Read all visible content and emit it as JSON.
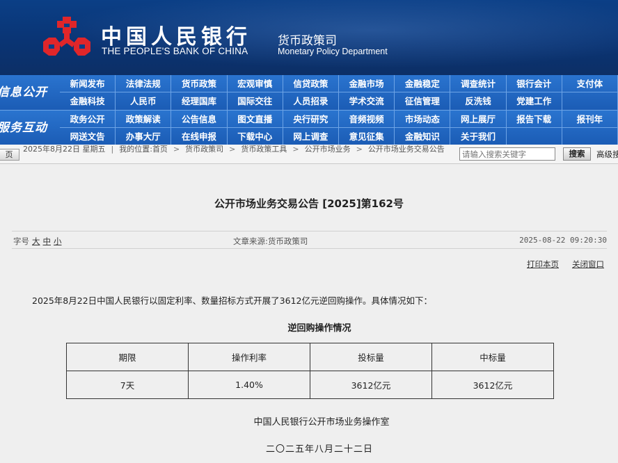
{
  "header": {
    "bank_name_cn": "中国人民银行",
    "bank_name_en": "THE PEOPLE'S BANK OF CHINA",
    "dept_cn": "货币政策司",
    "dept_en": "Monetary Policy Department",
    "logo_color": "#e0262a",
    "banner_color": "#0b3f86"
  },
  "nav": {
    "section1_title": "信息公开",
    "section2_title": "服务互动",
    "section1_row1": [
      "新闻发布",
      "法律法规",
      "货币政策",
      "宏观审慎",
      "信贷政策",
      "金融市场",
      "金融稳定",
      "调查统计",
      "银行会计",
      "支付体"
    ],
    "section1_row2": [
      "金融科技",
      "人民币",
      "经理国库",
      "国际交往",
      "人员招录",
      "学术交流",
      "征信管理",
      "反洗钱",
      "党建工作",
      ""
    ],
    "section2_row1": [
      "政务公开",
      "政策解读",
      "公告信息",
      "图文直播",
      "央行研究",
      "音频视频",
      "市场动态",
      "网上展厅",
      "报告下载",
      "报刊年"
    ],
    "section2_row2": [
      "网送文告",
      "办事大厅",
      "在线申报",
      "下载中心",
      "网上调查",
      "意见征集",
      "金融知识",
      "关于我们",
      "",
      ""
    ]
  },
  "breadcrumb": {
    "home_label": "页",
    "date": "2025年8月22日 星期五",
    "location_label": "我的位置:",
    "items": [
      "首页",
      "货币政策司",
      "货币政策工具",
      "公开市场业务",
      "公开市场业务交易公告"
    ]
  },
  "search": {
    "placeholder": "请输入搜索关键字",
    "button_label": "搜索",
    "advanced_label": "高级搜"
  },
  "article": {
    "title": "公开市场业务交易公告 [2025]第162号",
    "font_label": "字号",
    "font_large": "大",
    "font_medium": "中",
    "font_small": "小",
    "source": "文章来源:货币政策司",
    "pubdate": "2025-08-22 09:20:30",
    "print_label": "打印本页",
    "close_label": "关闭窗口",
    "body": "2025年8月22日中国人民银行以固定利率、数量招标方式开展了3612亿元逆回购操作。具体情况如下：",
    "table_caption": "逆回购操作情况",
    "table_headers": [
      "期限",
      "操作利率",
      "投标量",
      "中标量"
    ],
    "table_rows": [
      [
        "7天",
        "1.40%",
        "3612亿元",
        "3612亿元"
      ]
    ],
    "signature": "中国人民银行公开市场业务操作室",
    "sign_date": "二〇二五年八月二十二日"
  }
}
